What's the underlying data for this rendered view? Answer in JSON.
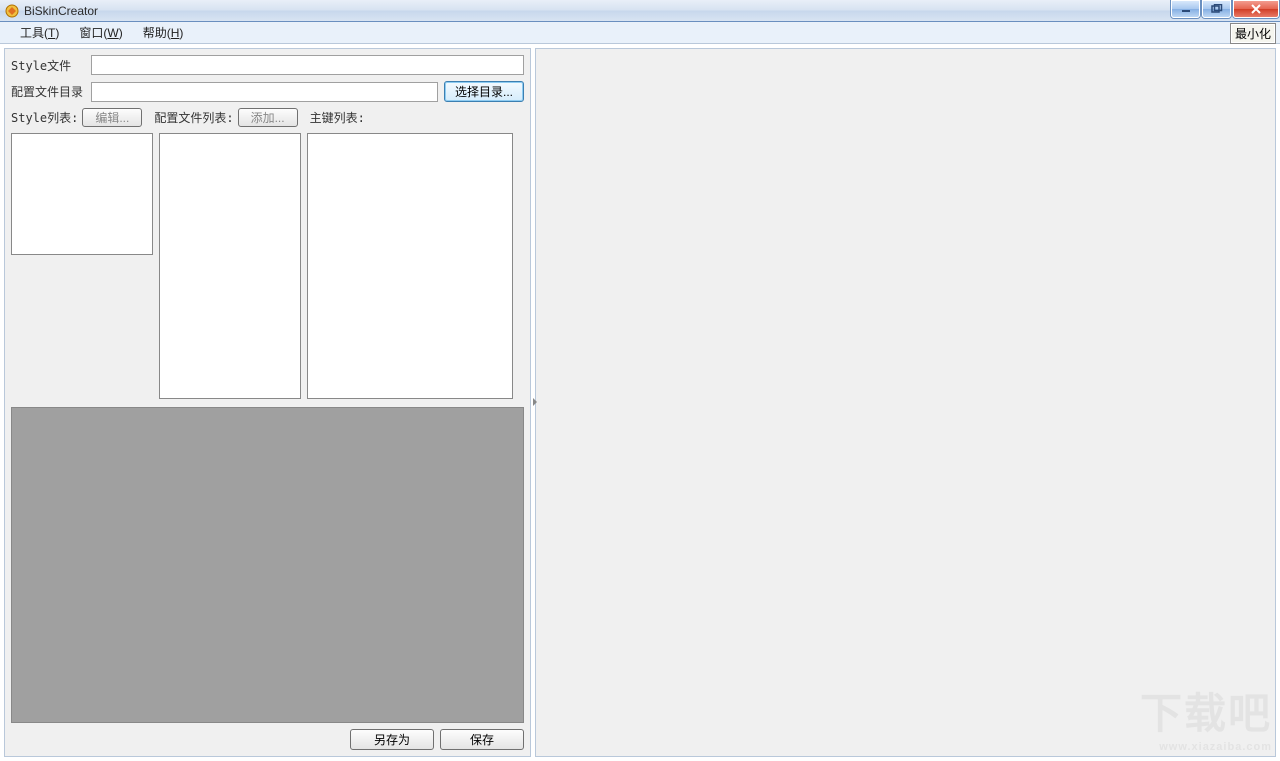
{
  "window": {
    "title": "BiSkinCreator"
  },
  "menubar": {
    "tools": "工具",
    "tools_key": "T",
    "window": "窗口",
    "window_key": "W",
    "help": "帮助",
    "help_key": "H",
    "minimize_btn": "最小化"
  },
  "labels": {
    "style_file": "Style文件",
    "config_dir": "配置文件目录",
    "choose_dir": "选择目录...",
    "style_list": "Style列表:",
    "edit": "编辑...",
    "config_list": "配置文件列表:",
    "add": "添加...",
    "key_list": "主键列表:",
    "save_as": "另存为",
    "save": "保存"
  },
  "fields": {
    "style_file_value": "",
    "config_dir_value": ""
  },
  "watermark": {
    "text": "下载吧",
    "url": "www.xiazaiba.com"
  }
}
